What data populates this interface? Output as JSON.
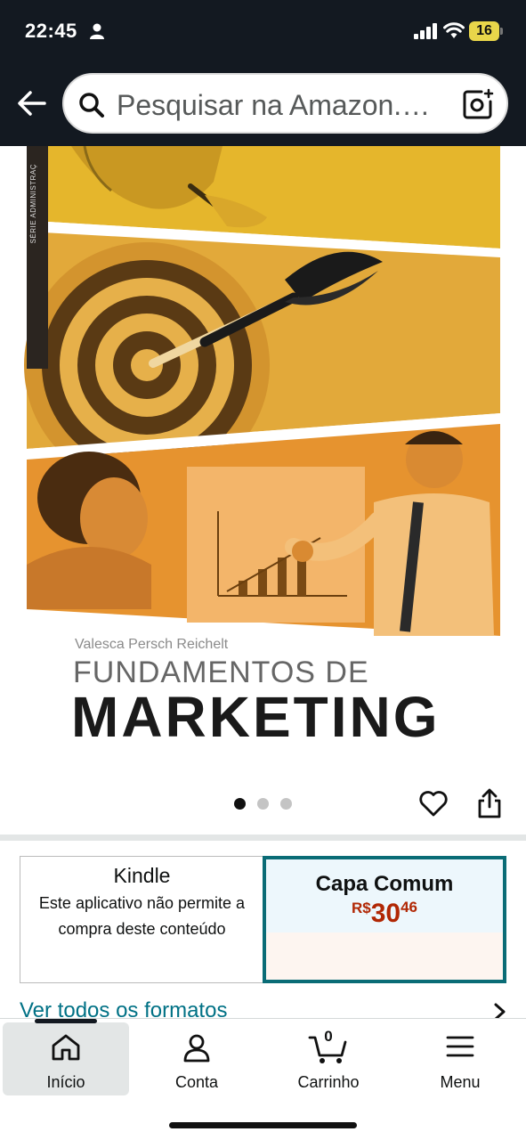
{
  "status_bar": {
    "time": "22:45",
    "battery": "16",
    "icons": [
      "person-icon",
      "signal-icon",
      "wifi-icon"
    ]
  },
  "search": {
    "placeholder": "Pesquisar na Amazon.…"
  },
  "cover": {
    "spine_text": "SÉRIE ADMINISTRAÇ",
    "author": "Valesca Persch Reichelt",
    "title_line1": "FUNDAMENTOS DE",
    "title_line2": "MARKETING"
  },
  "carousel": {
    "count": 3,
    "active_index": 0
  },
  "formats": {
    "kindle": {
      "title": "Kindle",
      "description": "Este aplicativo não permite a compra deste conteúdo"
    },
    "paperback": {
      "title": "Capa Comum",
      "price_currency": "R$",
      "price_whole": "30",
      "price_fraction": "46"
    },
    "see_all": "Ver todos os formatos"
  },
  "bottom_nav": {
    "items": [
      {
        "label": "Início",
        "icon": "home-icon",
        "active": true
      },
      {
        "label": "Conta",
        "icon": "account-icon",
        "active": false
      },
      {
        "label": "Carrinho",
        "icon": "cart-icon",
        "active": false,
        "count": "0"
      },
      {
        "label": "Menu",
        "icon": "menu-icon",
        "active": false
      }
    ]
  },
  "colors": {
    "header": "#131921",
    "link": "#007185",
    "price": "#b12704",
    "selected_border": "#0a6c76",
    "cover_yellow": "#e9b62a",
    "cover_orange": "#e6932f"
  }
}
